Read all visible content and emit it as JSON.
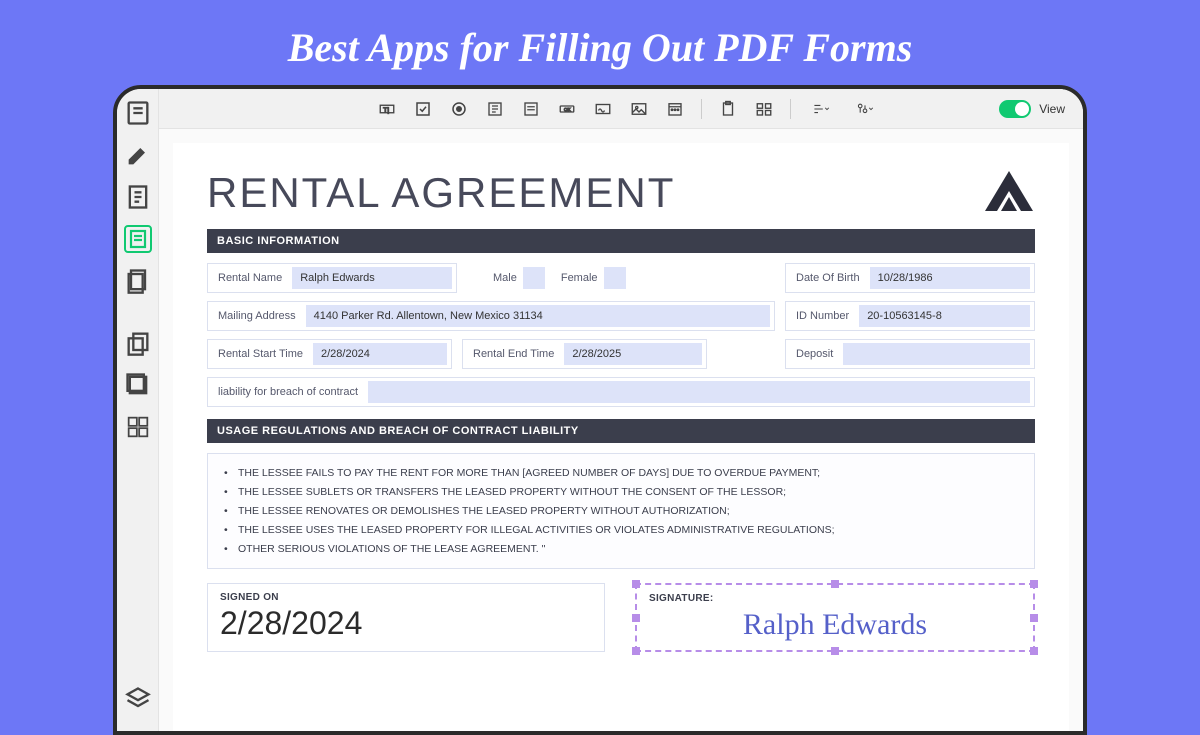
{
  "hero": {
    "title": "Best Apps for Filling Out PDF Forms"
  },
  "toolbar": {
    "view_label": "View"
  },
  "document": {
    "title": "RENTAL AGREEMENT",
    "section1": "BASIC INFORMATION",
    "section2": "USAGE REGULATIONS AND BREACH OF CONTRACT LIABILITY",
    "fields": {
      "rental_name_label": "Rental Name",
      "rental_name_value": "Ralph Edwards",
      "male_label": "Male",
      "female_label": "Female",
      "dob_label": "Date Of Birth",
      "dob_value": "10/28/1986",
      "mailing_label": "Mailing Address",
      "mailing_value": "4140 Parker Rd. Allentown, New Mexico 31134",
      "id_label": "ID Number",
      "id_value": "20-10563145-8",
      "start_label": "Rental Start Time",
      "start_value": "2/28/2024",
      "end_label": "Rental End Time",
      "end_value": "2/28/2025",
      "deposit_label": "Deposit",
      "liability_label": "liability for breach of contract"
    },
    "usage_items": [
      "THE LESSEE FAILS TO PAY THE RENT FOR MORE THAN [AGREED NUMBER OF DAYS] DUE TO OVERDUE PAYMENT;",
      "THE LESSEE SUBLETS OR TRANSFERS THE LEASED PROPERTY WITHOUT THE CONSENT OF THE LESSOR;",
      "THE LESSEE RENOVATES OR DEMOLISHES THE LEASED PROPERTY WITHOUT AUTHORIZATION;",
      "THE LESSEE USES THE LEASED PROPERTY FOR ILLEGAL ACTIVITIES OR VIOLATES ADMINISTRATIVE REGULATIONS;",
      "OTHER SERIOUS VIOLATIONS OF THE LEASE AGREEMENT. \""
    ],
    "signed_label": "SIGNED ON",
    "signed_value": "2/28/2024",
    "signature_label": "SIGNATURE:",
    "signature_value": "Ralph Edwards"
  }
}
